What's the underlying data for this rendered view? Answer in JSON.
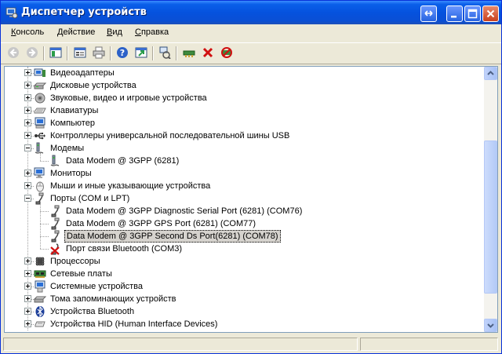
{
  "window": {
    "title": "Диспетчер устройств"
  },
  "menu": [
    {
      "label": "Консоль"
    },
    {
      "label": "Действие"
    },
    {
      "label": "Вид"
    },
    {
      "label": "Справка"
    }
  ],
  "toolbar": [
    {
      "name": "back-icon"
    },
    {
      "name": "forward-icon"
    },
    {
      "name": "console-tree-icon"
    },
    {
      "name": "properties-icon"
    },
    {
      "name": "print-icon"
    },
    {
      "name": "help-icon"
    },
    {
      "name": "export-icon"
    },
    {
      "name": "scan-hardware-icon"
    },
    {
      "name": "update-driver-icon"
    },
    {
      "name": "uninstall-icon"
    },
    {
      "name": "disable-icon"
    }
  ],
  "tree": [
    {
      "label": "Видеоадаптеры",
      "icon": "display-adapter-icon",
      "level": 1,
      "state": "collapsed"
    },
    {
      "label": "Дисковые устройства",
      "icon": "disk-drive-icon",
      "level": 1,
      "state": "collapsed"
    },
    {
      "label": "Звуковые, видео и игровые устройства",
      "icon": "sound-icon",
      "level": 1,
      "state": "collapsed"
    },
    {
      "label": "Клавиатуры",
      "icon": "keyboard-icon",
      "level": 1,
      "state": "collapsed"
    },
    {
      "label": "Компьютер",
      "icon": "computer-icon",
      "level": 1,
      "state": "collapsed"
    },
    {
      "label": "Контроллеры универсальной последовательной шины USB",
      "icon": "usb-icon",
      "level": 1,
      "state": "collapsed"
    },
    {
      "label": "Модемы",
      "icon": "modem-icon",
      "level": 1,
      "state": "expanded"
    },
    {
      "label": "Data Modem @ 3GPP (6281)",
      "icon": "modem-icon",
      "level": 2
    },
    {
      "label": "Мониторы",
      "icon": "monitor-icon",
      "level": 1,
      "state": "collapsed"
    },
    {
      "label": "Мыши и иные указывающие устройства",
      "icon": "mouse-icon",
      "level": 1,
      "state": "collapsed"
    },
    {
      "label": "Порты (COM и LPT)",
      "icon": "port-icon",
      "level": 1,
      "state": "expanded"
    },
    {
      "label": "Data Modem @ 3GPP Diagnostic Serial Port (6281) (COM76)",
      "icon": "port-icon",
      "level": 2
    },
    {
      "label": "Data Modem @ 3GPP GPS Port (6281) (COM77)",
      "icon": "port-icon",
      "level": 2
    },
    {
      "label": "Data Modem @ 3GPP Second Ds Port(6281) (COM78)",
      "icon": "port-icon",
      "level": 2,
      "selected": true
    },
    {
      "label": "Порт связи Bluetooth (COM3)",
      "icon": "port-disabled-icon",
      "level": 2
    },
    {
      "label": "Процессоры",
      "icon": "processor-icon",
      "level": 1,
      "state": "collapsed"
    },
    {
      "label": "Сетевые платы",
      "icon": "network-card-icon",
      "level": 1,
      "state": "collapsed"
    },
    {
      "label": "Системные устройства",
      "icon": "system-device-icon",
      "level": 1,
      "state": "collapsed"
    },
    {
      "label": "Тома запоминающих устройств",
      "icon": "storage-volume-icon",
      "level": 1,
      "state": "collapsed"
    },
    {
      "label": "Устройства Bluetooth",
      "icon": "bluetooth-icon",
      "level": 1,
      "state": "collapsed"
    },
    {
      "label": "Устройства HID (Human Interface Devices)",
      "icon": "hid-icon",
      "level": 1,
      "state": "collapsed"
    }
  ],
  "colors": {
    "titlebar": "#0552de",
    "selection": "#d6d3ce",
    "window_bg": "#ece9d8"
  }
}
